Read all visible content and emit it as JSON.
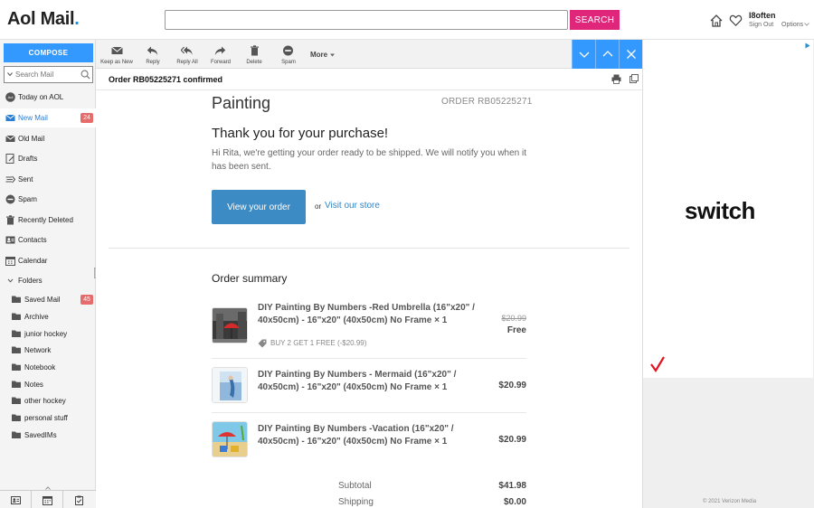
{
  "header": {
    "logo": "Aol Mail",
    "search_placeholder": "",
    "search_button": "SEARCH",
    "user_name": "I8often",
    "sign_out": "Sign Out",
    "options": "Options"
  },
  "nav": {
    "compose": "COMPOSE",
    "search_placeholder": "Search Mail",
    "items": [
      {
        "label": "Today on AOL",
        "icon": "aol-icon"
      },
      {
        "label": "New Mail",
        "icon": "inbox-icon",
        "badge": "24",
        "active": true
      },
      {
        "label": "Old Mail",
        "icon": "mail-icon"
      },
      {
        "label": "Drafts",
        "icon": "drafts-icon"
      },
      {
        "label": "Sent",
        "icon": "sent-icon"
      },
      {
        "label": "Spam",
        "icon": "spam-icon"
      },
      {
        "label": "Recently Deleted",
        "icon": "trash-icon"
      },
      {
        "label": "Contacts",
        "icon": "contacts-icon"
      },
      {
        "label": "Calendar",
        "icon": "calendar-icon"
      },
      {
        "label": "Folders",
        "icon": "chevron-down-icon"
      }
    ],
    "folders": [
      {
        "label": "Saved Mail",
        "badge": "45"
      },
      {
        "label": "Archive"
      },
      {
        "label": "junior hockey"
      },
      {
        "label": "Network"
      },
      {
        "label": "Notebook"
      },
      {
        "label": "Notes"
      },
      {
        "label": "other hockey"
      },
      {
        "label": "personal stuff"
      },
      {
        "label": "SavedIMs"
      }
    ]
  },
  "toolbar": {
    "keep_as_new": "Keep as New",
    "reply": "Reply",
    "reply_all": "Reply All",
    "forward": "Forward",
    "delete": "Delete",
    "spam": "Spam",
    "more": "More"
  },
  "message": {
    "subject": "Order RB05225271 confirmed",
    "shop_name": "Painting",
    "order_number": "ORDER RB05225271",
    "thanks": "Thank you for your purchase!",
    "body": "Hi Rita, we're getting your order ready to be shipped. We will notify you when it has been sent.",
    "view_order": "View your order",
    "or": "or",
    "visit_store": "Visit our store",
    "summary_title": "Order summary",
    "items": [
      {
        "name": "DIY Painting By Numbers -Red Umbrella (16\"x20\" / 40x50cm) - 16\"x20\" (40x50cm) No Frame × 1",
        "old_price": "$20.99",
        "price": "Free",
        "discount": "BUY 2 GET 1 FREE (-$20.99)"
      },
      {
        "name": "DIY Painting By Numbers - Mermaid (16\"x20\" / 40x50cm) - 16\"x20\" (40x50cm) No Frame × 1",
        "price": "$20.99"
      },
      {
        "name": "DIY Painting By Numbers -Vacation (16\"x20\" / 40x50cm) - 16\"x20\" (40x50cm) No Frame × 1",
        "price": "$20.99"
      }
    ],
    "subtotal_label": "Subtotal",
    "subtotal": "$41.98",
    "shipping_label": "Shipping",
    "shipping": "$0.00"
  },
  "ad": {
    "word": "switch",
    "footer": "© 2021 Verizon Media"
  },
  "colors": {
    "accent": "#3399ff",
    "search_button": "#e0267a",
    "badge": "#e86b6b",
    "link": "#2f86c8",
    "view_button": "#3d8bc4"
  }
}
